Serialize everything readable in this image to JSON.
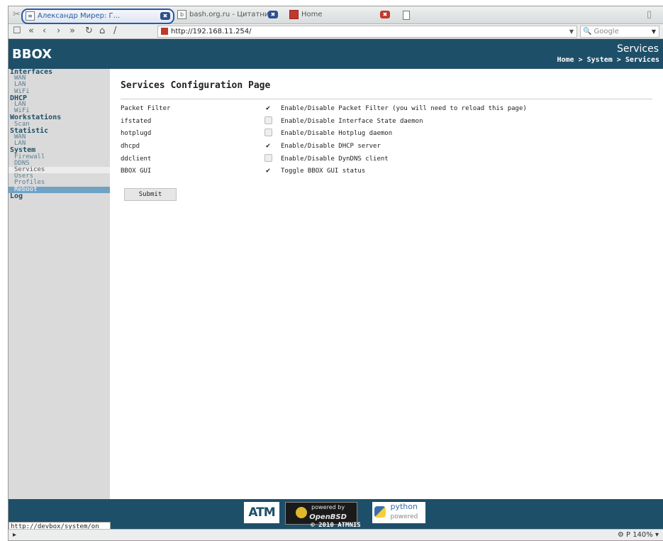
{
  "browser": {
    "tabs": [
      {
        "label": "Александр Мирер: Г...",
        "close": "✖"
      },
      {
        "label": "bash.org.ru - Цитатни...",
        "close": "✖"
      },
      {
        "label": "Home",
        "close": "✖"
      }
    ],
    "url": "http://192.168.11.254/",
    "search_placeholder": "Google",
    "status_url": "http://devbox/system/on",
    "zoom": "140%"
  },
  "header": {
    "logo": "BBOX",
    "title": "Services",
    "breadcrumb": "Home > System > Services"
  },
  "sidebar": {
    "sections": [
      {
        "label": "Interfaces",
        "items": [
          "WAN",
          "LAN",
          "WiFi"
        ]
      },
      {
        "label": "DHCP",
        "items": [
          "LAN",
          "WiFi"
        ]
      },
      {
        "label": "Workstations",
        "items": [
          "Scan"
        ]
      },
      {
        "label": "Statistic",
        "items": [
          "WAN",
          "LAN"
        ]
      },
      {
        "label": "System",
        "items": [
          "Firewall",
          "DDNS",
          "Services",
          "Users",
          "Profiles",
          "Reboot"
        ]
      },
      {
        "label": "Log",
        "items": []
      }
    ]
  },
  "main": {
    "title": "Services Configuration Page",
    "rows": [
      {
        "name": "Packet Filter",
        "checked": true,
        "desc": "Enable/Disable Packet Filter (you will need to reload this page)"
      },
      {
        "name": "ifstated",
        "checked": false,
        "desc": "Enable/Disable Interface State daemon"
      },
      {
        "name": "hotplugd",
        "checked": false,
        "desc": "Enable/Disable Hotplug daemon"
      },
      {
        "name": "dhcpd",
        "checked": true,
        "desc": "Enable/Disable DHCP server"
      },
      {
        "name": "ddclient",
        "checked": false,
        "desc": "Enable/Disable DynDNS client"
      },
      {
        "name": "BBOX GUI",
        "checked": true,
        "desc": "Toggle BBOX GUI status"
      }
    ],
    "submit_label": "Submit"
  },
  "footer": {
    "atms_logo": "ATM",
    "openbsd_top": "powered by",
    "openbsd_name": "OpenBSD",
    "python_top": "python",
    "python_sub": "powered",
    "copyright": "© 2010 ATMNIS"
  },
  "colors": {
    "header": "#1e4f68",
    "sidebar": "#dadada",
    "active_item": "#6fa2c4"
  }
}
